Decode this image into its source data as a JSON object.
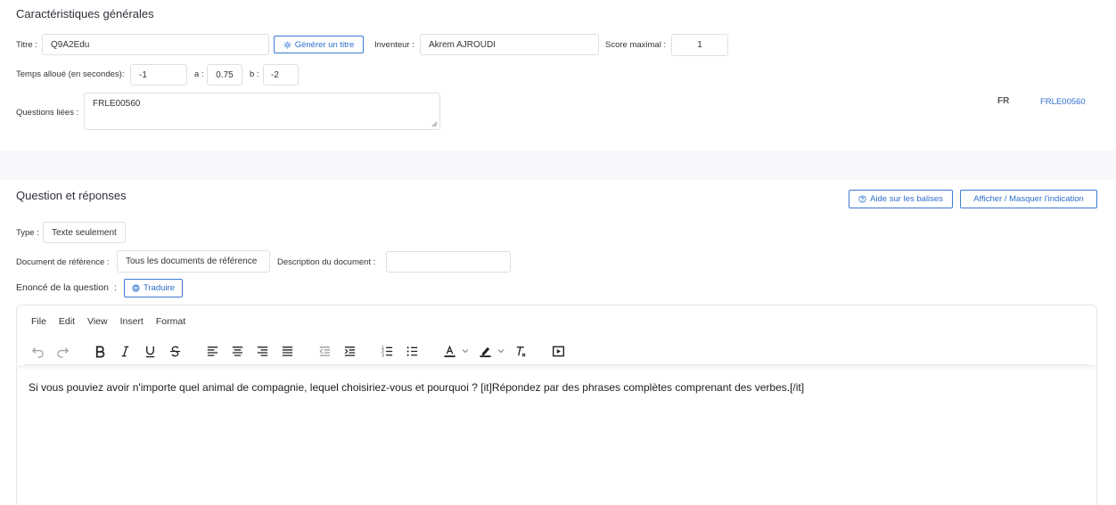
{
  "general": {
    "section_title": "Caractéristiques générales",
    "title_label": "Titre :",
    "title_value": "Q9A2Edu",
    "generate_title_button": "Générer un titre",
    "inventor_label": "Inventeur :",
    "inventor_value": "Akrem AJROUDI",
    "max_score_label": "Score maximal :",
    "max_score_value": "1",
    "time_label": "Temps alloué (en secondes):",
    "time_value": "-1",
    "a_label": "a :",
    "a_value": "0.75",
    "b_label": "b :",
    "b_value": "-2",
    "linked_label": "Questions liées :",
    "linked_value": "FRLE00560",
    "lang_code": "FR",
    "lang_link": "FRLE00560"
  },
  "question": {
    "section_title": "Question et réponses",
    "help_button": "Aide sur les balises",
    "toggle_hint_button": "Afficher / Masquer l'indication",
    "type_label": "Type :",
    "type_value": "Texte seulement",
    "ref_doc_label": "Document de référence :",
    "ref_doc_value": "Tous les documents de référence",
    "doc_desc_label": "Description du document :",
    "doc_desc_value": "",
    "statement_label": "Enoncé de la question",
    "statement_colon": ":",
    "translate_button": "Traduire"
  },
  "editor": {
    "menu": [
      "File",
      "Edit",
      "View",
      "Insert",
      "Format"
    ],
    "toolbar_icons": [
      "undo-icon",
      "redo-icon",
      "bold-icon",
      "italic-icon",
      "underline-icon",
      "strikethrough-icon",
      "align-left-icon",
      "align-center-icon",
      "align-right-icon",
      "align-justify-icon",
      "outdent-icon",
      "indent-icon",
      "numbered-list-icon",
      "bulleted-list-icon",
      "text-color-icon",
      "highlight-color-icon",
      "clear-format-icon",
      "media-icon"
    ],
    "content": "Si vous pouviez avoir n'importe quel animal de compagnie, lequel choisiriez-vous et pourquoi ? [it]Répondez par des phrases complètes comprenant des verbes.[/it]"
  },
  "colors": {
    "accent": "#2f6fd0",
    "band": "#f6f7fa",
    "border": "#dcdfe6"
  }
}
